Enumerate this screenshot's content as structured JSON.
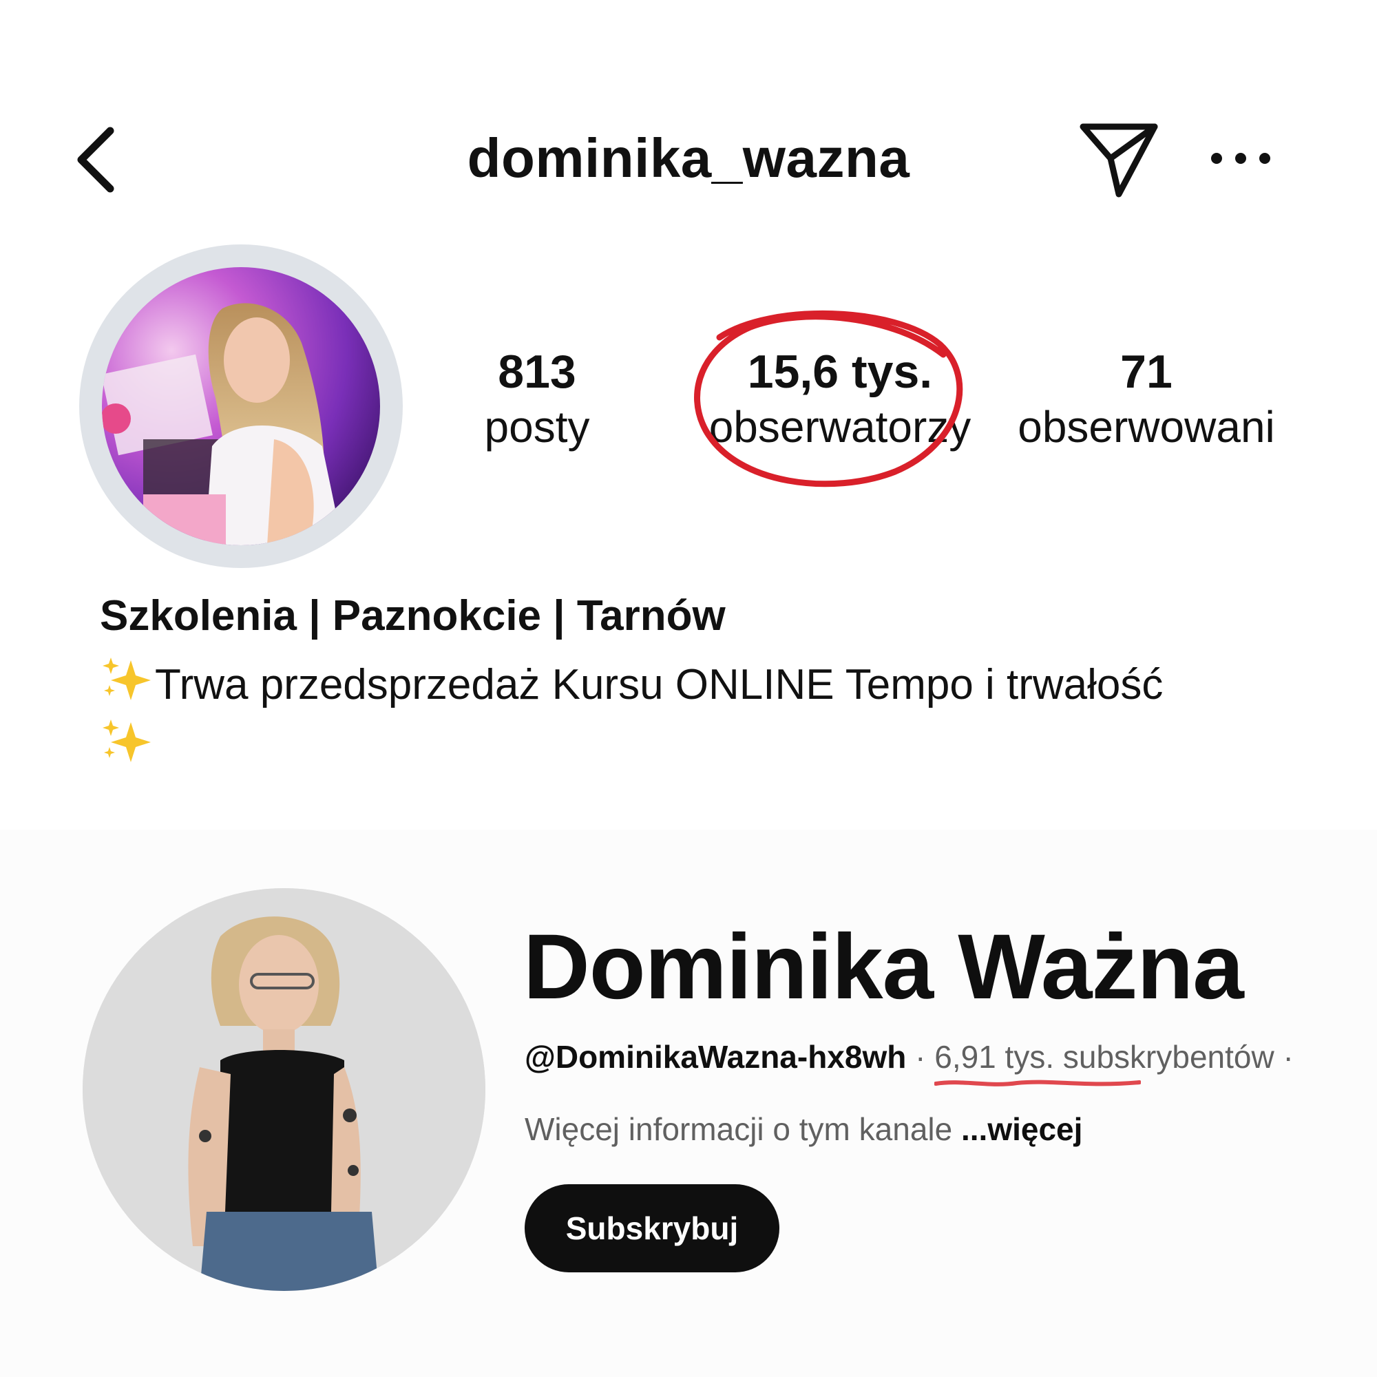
{
  "instagram": {
    "username": "dominika_wazna",
    "icons": {
      "back": "chevron-left-icon",
      "share": "paper-plane-icon",
      "more": "more-horizontal-icon"
    },
    "stats": {
      "posts": {
        "value": "813",
        "label": "posty"
      },
      "followers": {
        "value": "15,6 tys.",
        "label": "obserwatorzy"
      },
      "following": {
        "value": "71",
        "label": "obserwowani"
      }
    },
    "profile_name": "Szkolenia | Paznokcie | Tarnów",
    "bio_text": "Trwa przedsprzedaż Kursu ONLINE Tempo i trwałość",
    "annotation_color": "#d9202a"
  },
  "youtube": {
    "channel_name": "Dominika Ważna",
    "handle": "@DominikaWazna-hx8wh",
    "separator": "·",
    "subscribers": "6,91 tys. subskrybentów",
    "description": "Więcej informacji o tym kanale",
    "more_label": "...więcej",
    "subscribe_label": "Subskrybuj",
    "underline_color": "#e0484e"
  }
}
